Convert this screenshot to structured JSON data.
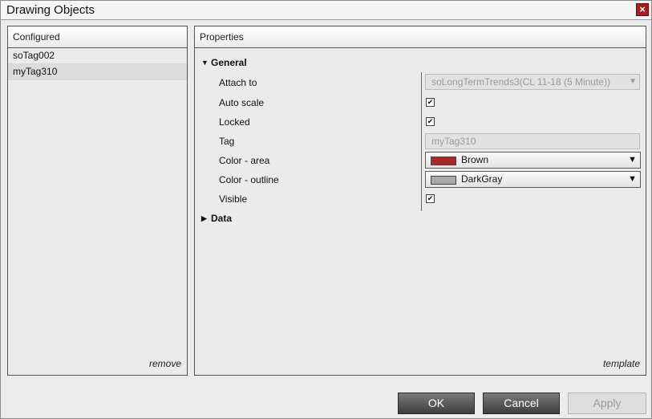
{
  "window": {
    "title": "Drawing Objects",
    "close_icon": "×"
  },
  "configured": {
    "header": "Configured",
    "items": [
      {
        "label": "soTag002",
        "selected": false
      },
      {
        "label": "myTag310",
        "selected": true
      }
    ],
    "remove_label": "remove"
  },
  "properties": {
    "header": "Properties",
    "general": {
      "label": "General",
      "expanded": true
    },
    "data": {
      "label": "Data",
      "expanded": false
    },
    "attach_to": {
      "label": "Attach to",
      "value": "soLongTermTrends3(CL 11-18 (5 Minute))"
    },
    "auto_scale": {
      "label": "Auto scale",
      "checked": true
    },
    "locked": {
      "label": "Locked",
      "checked": true
    },
    "tag": {
      "label": "Tag",
      "value": "myTag310"
    },
    "color_area": {
      "label": "Color - area",
      "value": "Brown",
      "color": "#a52a2a"
    },
    "color_outline": {
      "label": "Color - outline",
      "value": "DarkGray",
      "color": "#a9a9a9"
    },
    "visible": {
      "label": "Visible",
      "checked": true
    },
    "template_label": "template"
  },
  "buttons": {
    "ok": "OK",
    "cancel": "Cancel",
    "apply": "Apply"
  }
}
